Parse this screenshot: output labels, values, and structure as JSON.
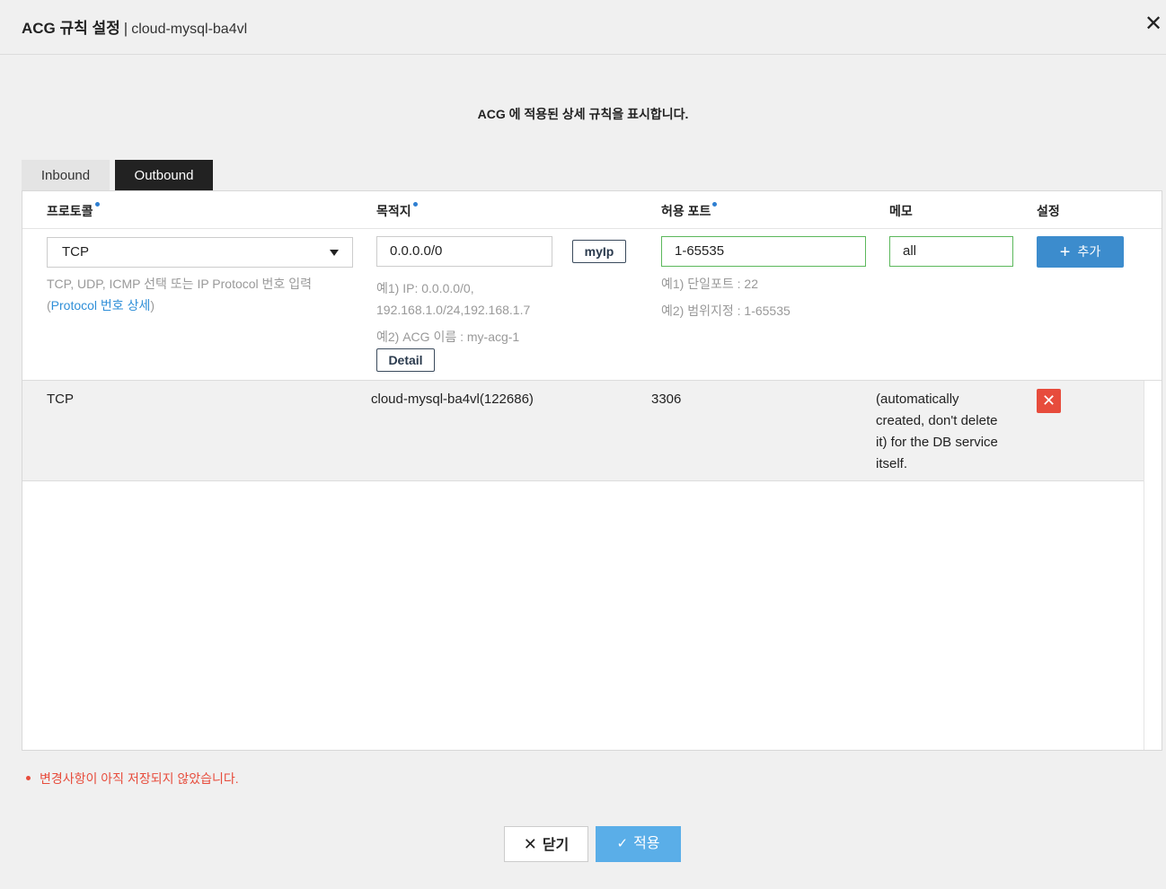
{
  "header": {
    "title": "ACG 규칙 설정",
    "separator": "|",
    "subtitle": "cloud-mysql-ba4vl",
    "close_icon": "✕"
  },
  "description": "ACG 에 적용된 상세 규칙을 표시합니다.",
  "tabs": [
    {
      "label": "Inbound",
      "active": false
    },
    {
      "label": "Outbound",
      "active": true
    }
  ],
  "columns": {
    "protocol": "프로토콜",
    "destination": "목적지",
    "port": "허용 포트",
    "memo": "메모",
    "settings": "설정"
  },
  "form": {
    "protocol_value": "TCP",
    "protocol_help_1": "TCP, UDP, ICMP 선택 또는 IP Protocol 번호 입력",
    "protocol_help_paren_open": "(",
    "protocol_help_link": "Protocol 번호 상세",
    "protocol_help_paren_close": ")",
    "destination_value": "0.0.0.0/0",
    "myip_label": "myIp",
    "destination_help_1": "예1) IP: 0.0.0.0/0,",
    "destination_help_2": "192.168.1.0/24,192.168.1.7",
    "destination_help_3": "예2) ACG 이름 : my-acg-1",
    "detail_label": "Detail",
    "port_value": "1-65535",
    "port_help_1": "예1) 단일포트 : 22",
    "port_help_2": "예2) 범위지정 : 1-65535",
    "memo_value": "all",
    "add_label": "추가",
    "add_icon": "+"
  },
  "rules": [
    {
      "protocol": "TCP",
      "destination": "cloud-mysql-ba4vl(122686)",
      "port": "3306",
      "memo_lines": [
        "(automatically",
        "created, don't delete",
        "it) for the DB service",
        "itself."
      ],
      "delete_icon": "✕"
    }
  ],
  "unsaved_message": "변경사항이 아직 저장되지 않았습니다.",
  "footer": {
    "close_label": "닫기",
    "close_icon": "✕",
    "apply_label": "적용",
    "apply_icon": "✓"
  },
  "colors": {
    "accent_blue": "#3c8ccd",
    "apply_blue": "#5aaee8",
    "success_green": "#5cb85c",
    "danger_red": "#e74c3c",
    "link_blue": "#2f8fd8"
  }
}
